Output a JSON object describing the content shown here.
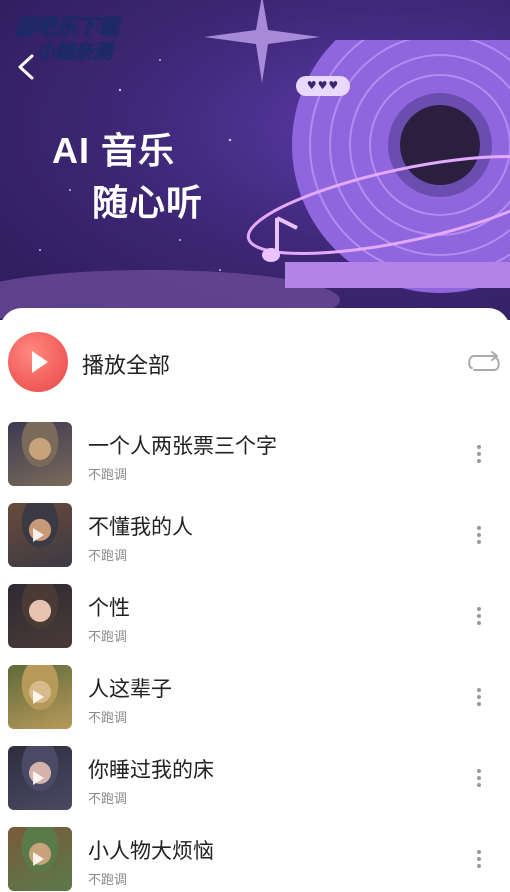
{
  "watermark": {
    "line1": "游吧乐下载",
    "line2": "小编亲测"
  },
  "hero": {
    "line1": "AI 音乐",
    "line2": "随心听",
    "badge": "♥♥♥"
  },
  "play_all": {
    "label": "播放全部",
    "icon": "play-icon",
    "loop_icon": "loop-icon"
  },
  "songs": [
    {
      "title": "一个人两张票三个字",
      "subtitle": "不跑调",
      "cover_colors": [
        "#7a6a5a",
        "#c7a27a",
        "#3d3a52"
      ],
      "show_play": false
    },
    {
      "title": "不懂我的人",
      "subtitle": "不跑调",
      "cover_colors": [
        "#3b3a44",
        "#c89a78",
        "#6a4b3a"
      ],
      "show_play": true
    },
    {
      "title": "个性",
      "subtitle": "不跑调",
      "cover_colors": [
        "#4a3a36",
        "#e7c3b0",
        "#2e2a34"
      ],
      "show_play": false
    },
    {
      "title": "人这辈子",
      "subtitle": "不跑调",
      "cover_colors": [
        "#b79a5a",
        "#d9b889",
        "#5e6a3a"
      ],
      "show_play": true
    },
    {
      "title": "你睡过我的床",
      "subtitle": "不跑调",
      "cover_colors": [
        "#4a4a66",
        "#d5b3a8",
        "#2f2c3c"
      ],
      "show_play": true
    },
    {
      "title": "小人物大烦恼",
      "subtitle": "不跑调",
      "cover_colors": [
        "#5a7a4a",
        "#c8a278",
        "#7a5a3a"
      ],
      "show_play": true
    }
  ],
  "colors": {
    "banner": "#3f2878",
    "accent": "#f25f5c",
    "record": "#a07be8"
  }
}
